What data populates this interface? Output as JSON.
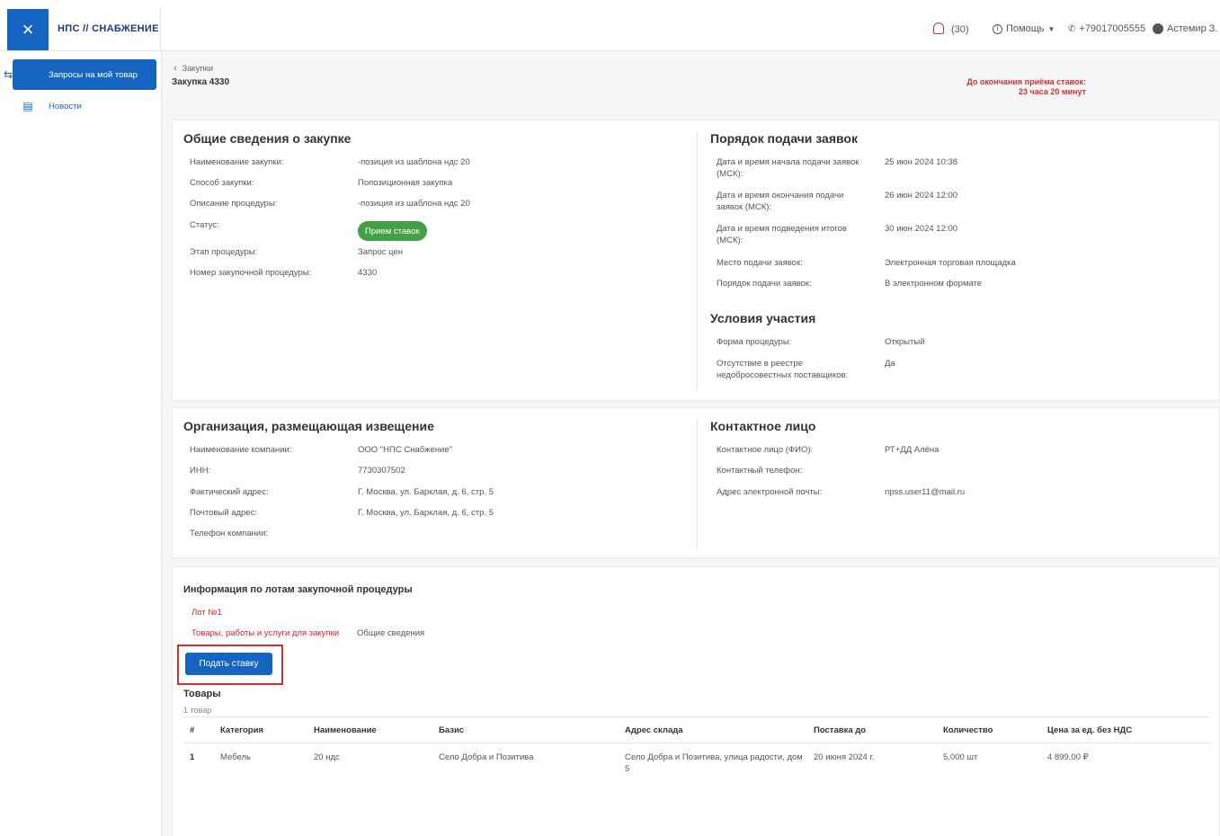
{
  "header": {
    "close_glyph": "×",
    "logo": "НПС // СНАБЖЕНИЕ",
    "notifications": "(30)",
    "help": "Помощь",
    "phone": "+79017005555",
    "user": "Астемир З."
  },
  "sidebar": {
    "items": [
      {
        "label": "Запросы на мой товар",
        "icon": "swap-arrows-icon",
        "active": true
      },
      {
        "label": "Новости",
        "icon": "newspaper-icon",
        "active": false
      }
    ]
  },
  "page": {
    "back_label": "Закупки",
    "title": "Закупка 4330",
    "deadline_line1": "До окончания приёма ставок:",
    "deadline_line2": "23 часа 20 минут"
  },
  "general": {
    "title": "Общие сведения о закупке",
    "rows": [
      {
        "label": "Наименование закупки:",
        "value": "-позиция из шаблона ндс 20"
      },
      {
        "label": "Способ закупки:",
        "value": "Попозиционная закупка"
      },
      {
        "label": "Описание процедуры:",
        "value": "-позиция из шаблона ндс 20"
      },
      {
        "label": "Статус:",
        "value": "Прием ставок"
      },
      {
        "label": "Этап процедуры:",
        "value": "Запрос цен"
      },
      {
        "label": "Номер закупочной процедуры:",
        "value": "4330"
      }
    ]
  },
  "submission": {
    "title": "Порядок подачи заявок",
    "rows": [
      {
        "label": "Дата и время начала подачи заявок (МСК):",
        "value": "25 июн 2024 10:38"
      },
      {
        "label": "Дата и время окончания подачи заявок (МСК):",
        "value": "26 июн 2024 12:00"
      },
      {
        "label": "Дата и время подведения итогов (МСК):",
        "value": "30 июн 2024 12:00"
      },
      {
        "label": "Место подачи заявок:",
        "value": "Электронная торговая площадка"
      },
      {
        "label": "Порядок подачи заявок:",
        "value": "В электронном формате"
      }
    ]
  },
  "conditions": {
    "title": "Условия участия",
    "rows": [
      {
        "label": "Форма процедуры:",
        "value": "Открытый"
      },
      {
        "label": "Отсутствие в реестре недобросовестных поставщиков:",
        "value": "Да"
      }
    ]
  },
  "organization": {
    "title": "Организация, размещающая извещение",
    "rows": [
      {
        "label": "Наименование компании:",
        "value": "ООО \"НПС Снабжение\""
      },
      {
        "label": "ИНН:",
        "value": "7730307502"
      },
      {
        "label": "Фактический адрес:",
        "value": "Г. Москва, ул. Барклая, д. 6, стр. 5"
      },
      {
        "label": "Почтовый адрес:",
        "value": "Г. Москва, ул. Барклая, д. 6, стр. 5"
      },
      {
        "label": "Телефон компании:",
        "value": ""
      }
    ]
  },
  "contact": {
    "title": "Контактное лицо",
    "rows": [
      {
        "label": "Контактное лицо (ФИО):",
        "value": "РТ+ДД Алёна"
      },
      {
        "label": "Контактный телефон:",
        "value": ""
      },
      {
        "label": "Адрес электронной почты:",
        "value": "npss.user11@mail.ru"
      }
    ]
  },
  "lots": {
    "title": "Информация по лотам закупочной процедуры",
    "lot_label": "Лот №1",
    "tab_goods": "Товары, работы и услуги для закупки",
    "tab_general": "Общие сведения",
    "bid_button": "Подать ставку",
    "goods_title": "Товары",
    "goods_count": "1 товар",
    "columns": [
      "#",
      "Категория",
      "Наименование",
      "Базис",
      "Адрес склада",
      "Поставка до",
      "Количество",
      "Цена за ед. без НДС"
    ],
    "rows": [
      [
        "1",
        "Мебель",
        "20 ндс",
        "Село Добра и Позитива",
        "Село Добра и Позитива, улица радости, дом 5",
        "20 июня 2024 г.",
        "5,000 шт",
        "4 899,00 ₽"
      ]
    ]
  },
  "colors": {
    "primary": "#1565c0",
    "accent_red": "#d32f2f",
    "status_green": "#43a047"
  }
}
